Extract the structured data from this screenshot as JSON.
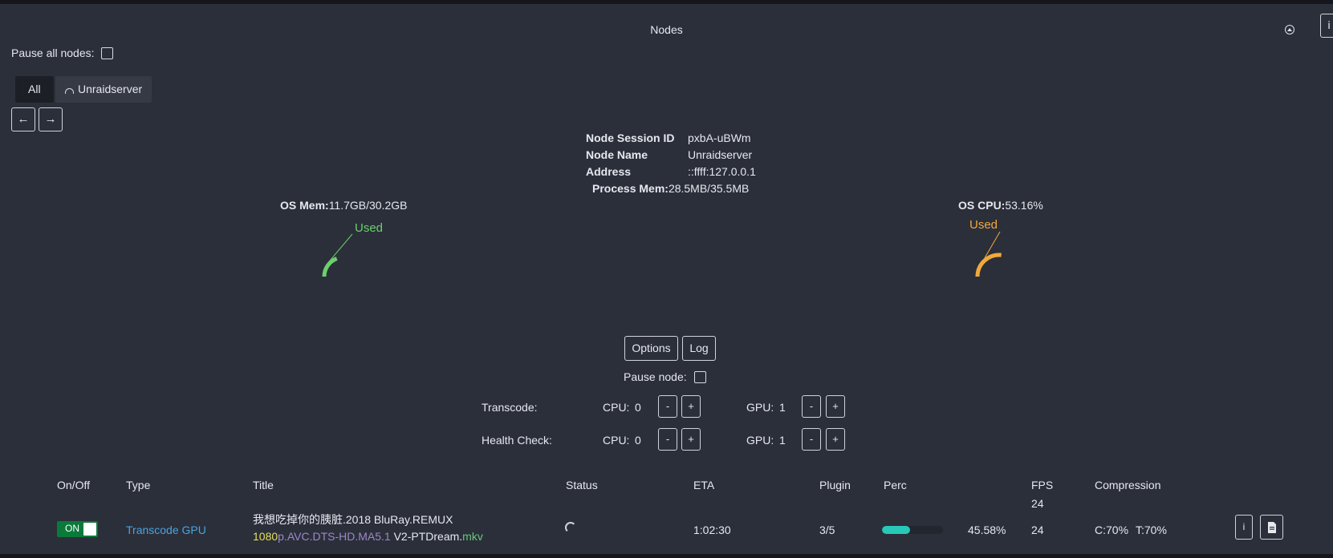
{
  "header": {
    "title": "Nodes"
  },
  "pause_all": {
    "label": "Pause all nodes:"
  },
  "tabs": [
    {
      "label": "All",
      "active": true
    },
    {
      "label": "Unraidserver",
      "active": false
    }
  ],
  "nav": {
    "prev": "←",
    "next": "→"
  },
  "info_btn": "i",
  "node_info": {
    "session_label": "Node Session ID",
    "session_value": "pxbA-uBWm",
    "name_label": "Node Name",
    "name_value": "Unraidserver",
    "address_label": "Address",
    "address_value": "::ffff:127.0.0.1",
    "procmem_label": "Process Mem:",
    "procmem_value": "28.5MB/35.5MB"
  },
  "os_mem": {
    "label": "OS Mem:",
    "value": "11.7GB/30.2GB",
    "used_label": "Used",
    "used_fraction": 0.387,
    "color": "#6ccf6c"
  },
  "os_cpu": {
    "label": "OS CPU:",
    "value": "53.16%",
    "used_label": "Used",
    "used_fraction": 0.5316,
    "color": "#f2a93b"
  },
  "node_buttons": {
    "options": "Options",
    "log": "Log"
  },
  "pause_node": {
    "label": "Pause node:"
  },
  "workers": [
    {
      "label": "Transcode:",
      "cpu_label": "CPU:",
      "cpu_value": "0",
      "gpu_label": "GPU:",
      "gpu_value": "1",
      "minus": "-",
      "plus": "+"
    },
    {
      "label": "Health Check:",
      "cpu_label": "CPU:",
      "cpu_value": "0",
      "gpu_label": "GPU:",
      "gpu_value": "1",
      "minus": "-",
      "plus": "+"
    }
  ],
  "table": {
    "headers": {
      "onoff": "On/Off",
      "type": "Type",
      "title": "Title",
      "status": "Status",
      "eta": "ETA",
      "plugin": "Plugin",
      "perc": "Perc",
      "fps": "FPS",
      "fps_sub": "24",
      "compression": "Compression"
    },
    "rows": [
      {
        "toggle": "ON",
        "type": "Transcode GPU",
        "title_a": "我想吃掉你的胰脏.2018 BluRay.REMUX ",
        "title_b": "1080",
        "title_c": "p.AVC.DTS-HD.MA5.1",
        "title_d": " V2-PTDream.",
        "title_e": "mkv",
        "eta": "1:02:30",
        "plugin": "3/5",
        "perc": "45.58%",
        "perc_value": 0.4558,
        "fps": "24",
        "comp_c": "C:70%",
        "comp_t": "T:70%",
        "info": "i",
        "doc_icon": "document-icon"
      }
    ]
  }
}
